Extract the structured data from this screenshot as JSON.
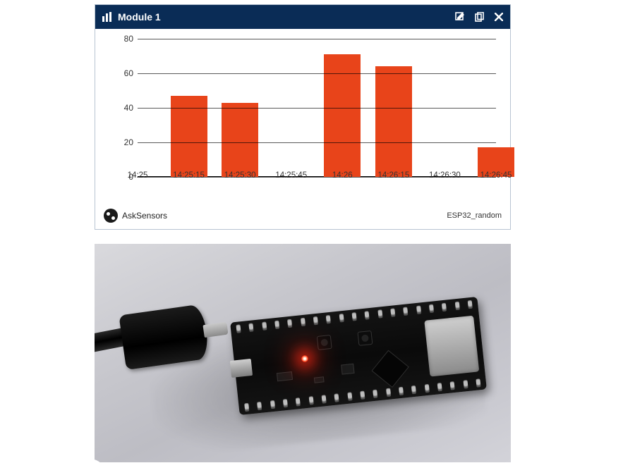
{
  "widget": {
    "title": "Module 1",
    "brand": "AskSensors",
    "device": "ESP32_random"
  },
  "colors": {
    "header_bg": "#0a2c56",
    "bar_fill": "#e8441a"
  },
  "chart_data": {
    "type": "bar",
    "title": "",
    "xlabel": "",
    "ylabel": "",
    "ylim": [
      0,
      80
    ],
    "yticks": [
      0,
      20,
      40,
      60,
      80
    ],
    "categories": [
      "14:25",
      "14:25:15",
      "14:25:30",
      "14:25:45",
      "14:26",
      "14:26:15",
      "14:26:30",
      "14:26:45"
    ],
    "values": [
      null,
      47,
      43,
      null,
      71,
      64,
      null,
      17
    ],
    "bars": [
      {
        "x": "14:25:15",
        "value": 47
      },
      {
        "x": "14:25:30",
        "value": 43
      },
      {
        "x": "14:26",
        "value": 71
      },
      {
        "x": "14:26:15",
        "value": 64
      },
      {
        "x": "14:26:45",
        "value": 17
      }
    ]
  }
}
